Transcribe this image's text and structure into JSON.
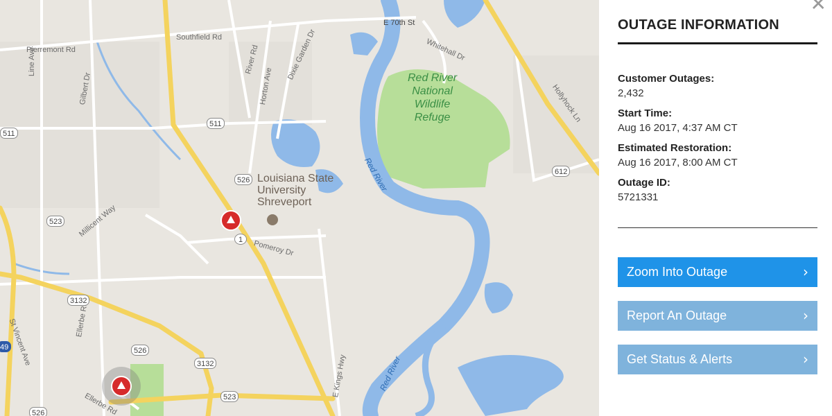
{
  "map": {
    "roads": {
      "pierremont": "Pierremont Rd",
      "southfield": "Southfield Rd",
      "line_ave": "Line Ave",
      "gilbert": "Gilbert Dr",
      "river_rd": "River Rd",
      "horton": "Horton Ave",
      "dixie": "Dixie Garden Dr",
      "e70th": "E 70th St",
      "whitehall": "Whitehall Dr",
      "hollyhock": "Hollyhock Ln",
      "millicent": "Millicent Way",
      "pomeroy": "Pomeroy Dr",
      "ellerbe": "Ellerbe Rd",
      "st_vincent": "St Vincent Ave",
      "e_kings": "E Kings Hwy",
      "ellerbe_bottom": "Ellerbe Rd"
    },
    "shields": {
      "s511_left": "511",
      "s511": "511",
      "s526": "526",
      "s523": "523",
      "s1": "1",
      "s3132": "3132",
      "s3132b": "3132",
      "s526b": "526",
      "s523b": "523",
      "s526c": "526",
      "s612": "612",
      "i49": "49"
    },
    "poi": {
      "lsu_line1": "Louisiana State",
      "lsu_line2": "University",
      "lsu_line3": "Shreveport"
    },
    "refuge": {
      "line1": "Red River",
      "line2": "National",
      "line3": "Wildlife",
      "line4": "Refuge"
    },
    "river": {
      "label1": "Red River",
      "label2": "Red River"
    },
    "marker_color": "#d62b2b",
    "water_color": "#8fb9e8",
    "park_color": "#b7de99"
  },
  "panel": {
    "title": "OUTAGE INFORMATION",
    "customer_outages_label": "Customer Outages:",
    "customer_outages_value": "2,432",
    "start_time_label": "Start Time:",
    "start_time_value": "Aug 16 2017, 4:37 AM CT",
    "est_restoration_label": "Estimated Restoration:",
    "est_restoration_value": "Aug 16 2017, 8:00 AM CT",
    "outage_id_label": "Outage ID:",
    "outage_id_value": "5721331",
    "buttons": {
      "zoom": "Zoom Into Outage",
      "report": "Report An Outage",
      "status": "Get Status & Alerts"
    },
    "accent_color": "#1f93e8"
  }
}
